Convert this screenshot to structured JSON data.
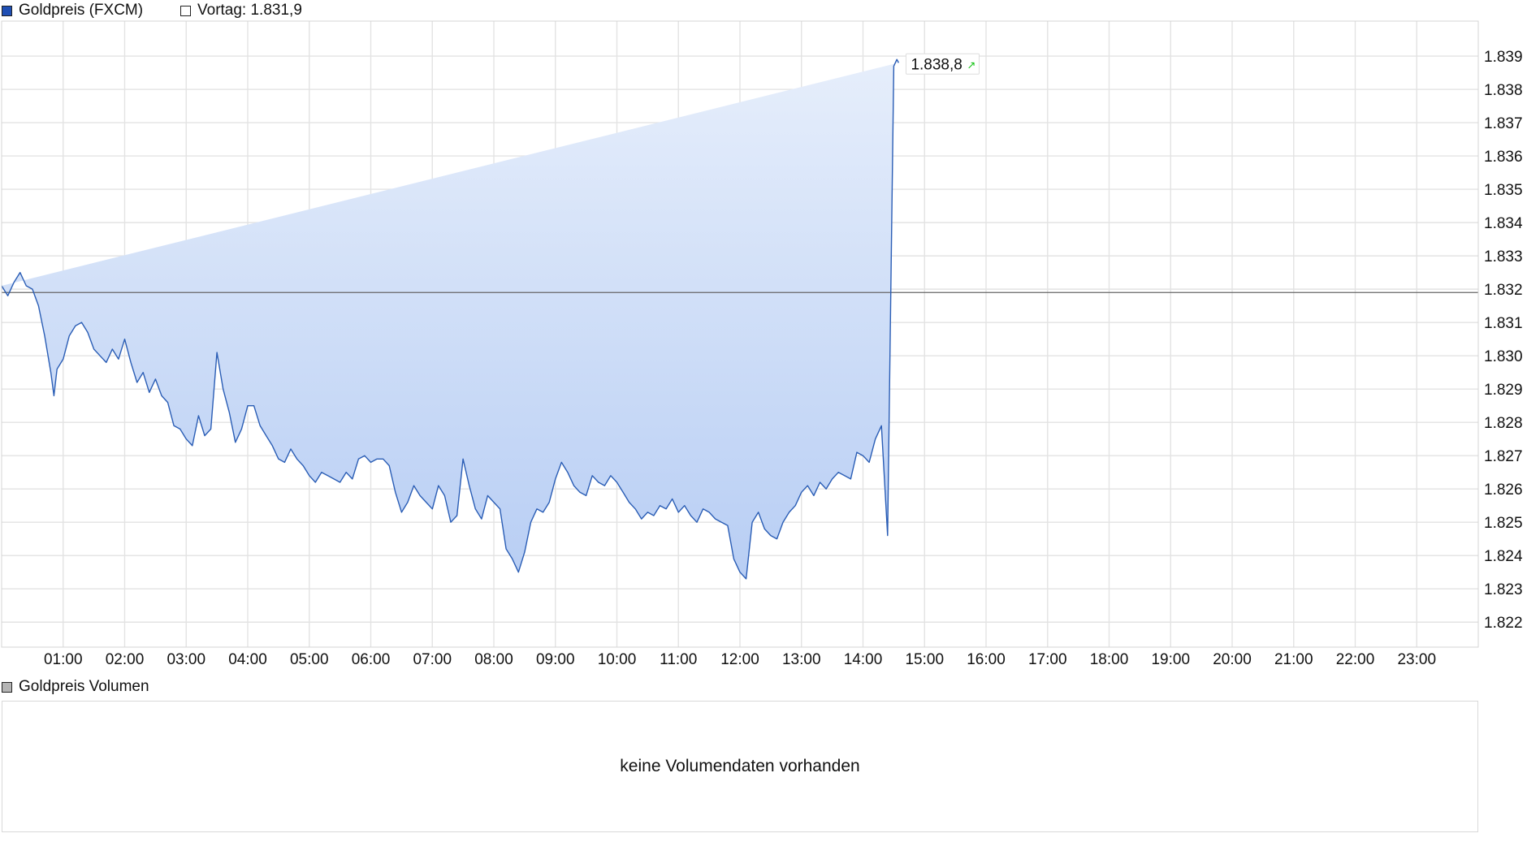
{
  "legend": {
    "series_label": "Goldpreis (FXCM)",
    "prev_label": "Vortag: 1.831,9"
  },
  "volume": {
    "label": "Goldpreis Volumen",
    "message": "keine Volumendaten vorhanden"
  },
  "colors": {
    "line": "#2a5db5",
    "fill_top": "#e6eefb",
    "fill_bottom": "#b8cef4",
    "grid": "#e3e3e3",
    "prev_line": "#666666",
    "arrow": "#18c418",
    "legend_series": "#1f4fb4",
    "legend_volume": "#b5b5b5"
  },
  "chart_data": {
    "type": "area",
    "title": "",
    "xlabel": "",
    "ylabel": "",
    "x_ticks": [
      "01:00",
      "02:00",
      "03:00",
      "04:00",
      "05:00",
      "06:00",
      "07:00",
      "08:00",
      "09:00",
      "10:00",
      "11:00",
      "12:00",
      "13:00",
      "14:00",
      "15:00",
      "16:00",
      "17:00",
      "18:00",
      "19:00",
      "20:00",
      "21:00",
      "22:00",
      "23:00"
    ],
    "y_ticks": [
      "1.822",
      "1.823",
      "1.824",
      "1.825",
      "1.826",
      "1.827",
      "1.828",
      "1.829",
      "1.830",
      "1.831",
      "1.832",
      "1.833",
      "1.834",
      "1.835",
      "1.836",
      "1.837",
      "1.838",
      "1.839"
    ],
    "xlim_hours": [
      0.0,
      24.0
    ],
    "ylim": [
      1821.25,
      1840.05
    ],
    "previous_close": 1831.9,
    "last_value_label": "1.838,8",
    "series": [
      {
        "x_hours": [
          0.0,
          0.1,
          0.2,
          0.3,
          0.4,
          0.5,
          0.6,
          0.7,
          0.8,
          0.85,
          0.9,
          1.0,
          1.1,
          1.2,
          1.3,
          1.4,
          1.5,
          1.6,
          1.7,
          1.8,
          1.9,
          2.0,
          2.1,
          2.2,
          2.3,
          2.4,
          2.5,
          2.6,
          2.7,
          2.8,
          2.9,
          3.0,
          3.1,
          3.2,
          3.3,
          3.4,
          3.5,
          3.6,
          3.7,
          3.8,
          3.9,
          4.0,
          4.1,
          4.2,
          4.3,
          4.4,
          4.5,
          4.6,
          4.7,
          4.8,
          4.9,
          5.0,
          5.1,
          5.2,
          5.3,
          5.4,
          5.5,
          5.6,
          5.7,
          5.8,
          5.9,
          6.0,
          6.1,
          6.2,
          6.3,
          6.4,
          6.5,
          6.6,
          6.7,
          6.8,
          6.9,
          7.0,
          7.1,
          7.2,
          7.3,
          7.4,
          7.5,
          7.6,
          7.7,
          7.8,
          7.9,
          8.0,
          8.1,
          8.2,
          8.3,
          8.4,
          8.5,
          8.6,
          8.7,
          8.8,
          8.9,
          9.0,
          9.1,
          9.2,
          9.3,
          9.4,
          9.5,
          9.6,
          9.7,
          9.8,
          9.9,
          10.0,
          10.1,
          10.2,
          10.3,
          10.4,
          10.5,
          10.6,
          10.7,
          10.8,
          10.9,
          11.0,
          11.1,
          11.2,
          11.3,
          11.4,
          11.5,
          11.6,
          11.7,
          11.8,
          11.9,
          12.0,
          12.1,
          12.2,
          12.3,
          12.4,
          12.5,
          12.6,
          12.7,
          12.8,
          12.9,
          13.0,
          13.1,
          13.2,
          13.3,
          13.4,
          13.5,
          13.6,
          13.7,
          13.8,
          13.9,
          14.0,
          14.1,
          14.2,
          14.3,
          14.4,
          14.5,
          14.55,
          14.58,
          14.6,
          14.62
        ],
        "values": [
          1832.1,
          1831.8,
          1832.2,
          1832.5,
          1832.1,
          1832.0,
          1831.5,
          1830.6,
          1829.5,
          1828.8,
          1829.6,
          1829.9,
          1830.6,
          1830.9,
          1831.0,
          1830.7,
          1830.2,
          1830.0,
          1829.8,
          1830.2,
          1829.9,
          1830.5,
          1829.8,
          1829.2,
          1829.5,
          1828.9,
          1829.3,
          1828.8,
          1828.6,
          1827.9,
          1827.8,
          1827.5,
          1827.3,
          1828.2,
          1827.6,
          1827.8,
          1830.1,
          1829.0,
          1828.3,
          1827.4,
          1827.8,
          1828.5,
          1828.5,
          1827.9,
          1827.6,
          1827.3,
          1826.9,
          1826.8,
          1827.2,
          1826.9,
          1826.7,
          1826.4,
          1826.2,
          1826.5,
          1826.4,
          1826.3,
          1826.2,
          1826.5,
          1826.3,
          1826.9,
          1827.0,
          1826.8,
          1826.9,
          1826.9,
          1826.7,
          1825.9,
          1825.3,
          1825.6,
          1826.1,
          1825.8,
          1825.6,
          1825.4,
          1826.1,
          1825.8,
          1825.0,
          1825.2,
          1826.9,
          1826.1,
          1825.4,
          1825.1,
          1825.8,
          1825.6,
          1825.4,
          1824.2,
          1823.9,
          1823.5,
          1824.1,
          1825.0,
          1825.4,
          1825.3,
          1825.6,
          1826.3,
          1826.8,
          1826.5,
          1826.1,
          1825.9,
          1825.8,
          1826.4,
          1826.2,
          1826.1,
          1826.4,
          1826.2,
          1825.9,
          1825.6,
          1825.4,
          1825.1,
          1825.3,
          1825.2,
          1825.5,
          1825.4,
          1825.7,
          1825.3,
          1825.5,
          1825.2,
          1825.0,
          1825.4,
          1825.3,
          1825.1,
          1825.0,
          1824.9,
          1823.9,
          1823.5,
          1823.3,
          1825.0,
          1825.3,
          1824.8,
          1824.6,
          1824.5,
          1825.0,
          1825.3,
          1825.5,
          1825.9,
          1826.1,
          1825.8,
          1826.2,
          1826.0,
          1826.3,
          1826.5,
          1826.4,
          1826.3,
          1827.1,
          1827.0,
          1826.8,
          1827.5,
          1827.9,
          1824.6,
          1838.7,
          1838.9,
          1838.8
        ],
        "fill": "area",
        "line_color": "#2a5db5"
      }
    ]
  }
}
